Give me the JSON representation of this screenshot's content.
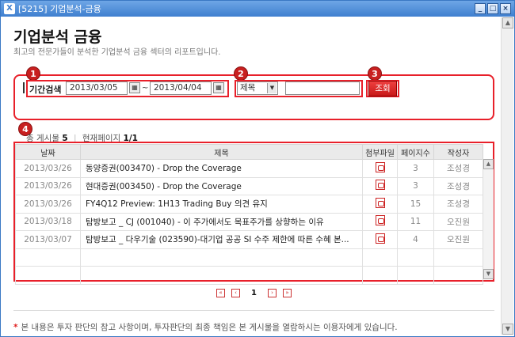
{
  "window": {
    "title": "[5215]  기업분석-금융",
    "app_icon": "X",
    "buttons": {
      "minimize": "_",
      "maximize": "□",
      "close": "×"
    }
  },
  "page": {
    "title": "기업분석 금융",
    "subtitle": "최고의 전문가들이 분석한 기업분석 금융 섹터의 리포트입니다."
  },
  "markers": [
    "1",
    "2",
    "3",
    "4"
  ],
  "search": {
    "period_label": "기간검색",
    "date_from": "2013/03/05",
    "date_sep": "~",
    "date_to": "2013/04/04",
    "field_select": "제목",
    "keyword": "",
    "search_button": "조회"
  },
  "info": {
    "total_label": "총 게시물",
    "total_count": "5",
    "separator": "|",
    "page_label": "현재페이지",
    "page_value": "1/1"
  },
  "table": {
    "columns": [
      "날짜",
      "제목",
      "첨부파일",
      "페이지수",
      "작성자"
    ],
    "rows": [
      {
        "date": "2013/03/26",
        "title": "동양증권(003470) - Drop the Coverage",
        "pages": "3",
        "author": "조성경"
      },
      {
        "date": "2013/03/26",
        "title": "현대증권(003450) - Drop the Coverage",
        "pages": "3",
        "author": "조성경"
      },
      {
        "date": "2013/03/26",
        "title": "FY4Q12 Preview: 1H13 Trading Buy 의견 유지",
        "pages": "15",
        "author": "조성경"
      },
      {
        "date": "2013/03/18",
        "title": "탐방보고 _ CJ (001040) - 이 주가에서도 목표주가를 상향하는 이유",
        "pages": "11",
        "author": "오진원"
      },
      {
        "date": "2013/03/07",
        "title": "탐방보고 _ 다우기술 (023590)-대기업 공공 SI 수주 제한에 따른 수혜 본...",
        "pages": "4",
        "author": "오진원"
      }
    ]
  },
  "pager": {
    "first": "«",
    "prev": "‹",
    "current": "1",
    "next": "›",
    "last": "»"
  },
  "notice": {
    "star": "*",
    "text": "본 내용은 투자 판단의 참고 사항이며, 투자판단의 최종 책임은 본 게시물을 열람하시는 이용자에게 있습니다."
  },
  "colors": {
    "accent": "#e8202a",
    "titlebar": "#3f7fcf"
  },
  "icons": [
    "calendar-icon",
    "pdf-icon",
    "dropdown-arrow-icon",
    "scroll-up-icon",
    "scroll-down-icon"
  ]
}
